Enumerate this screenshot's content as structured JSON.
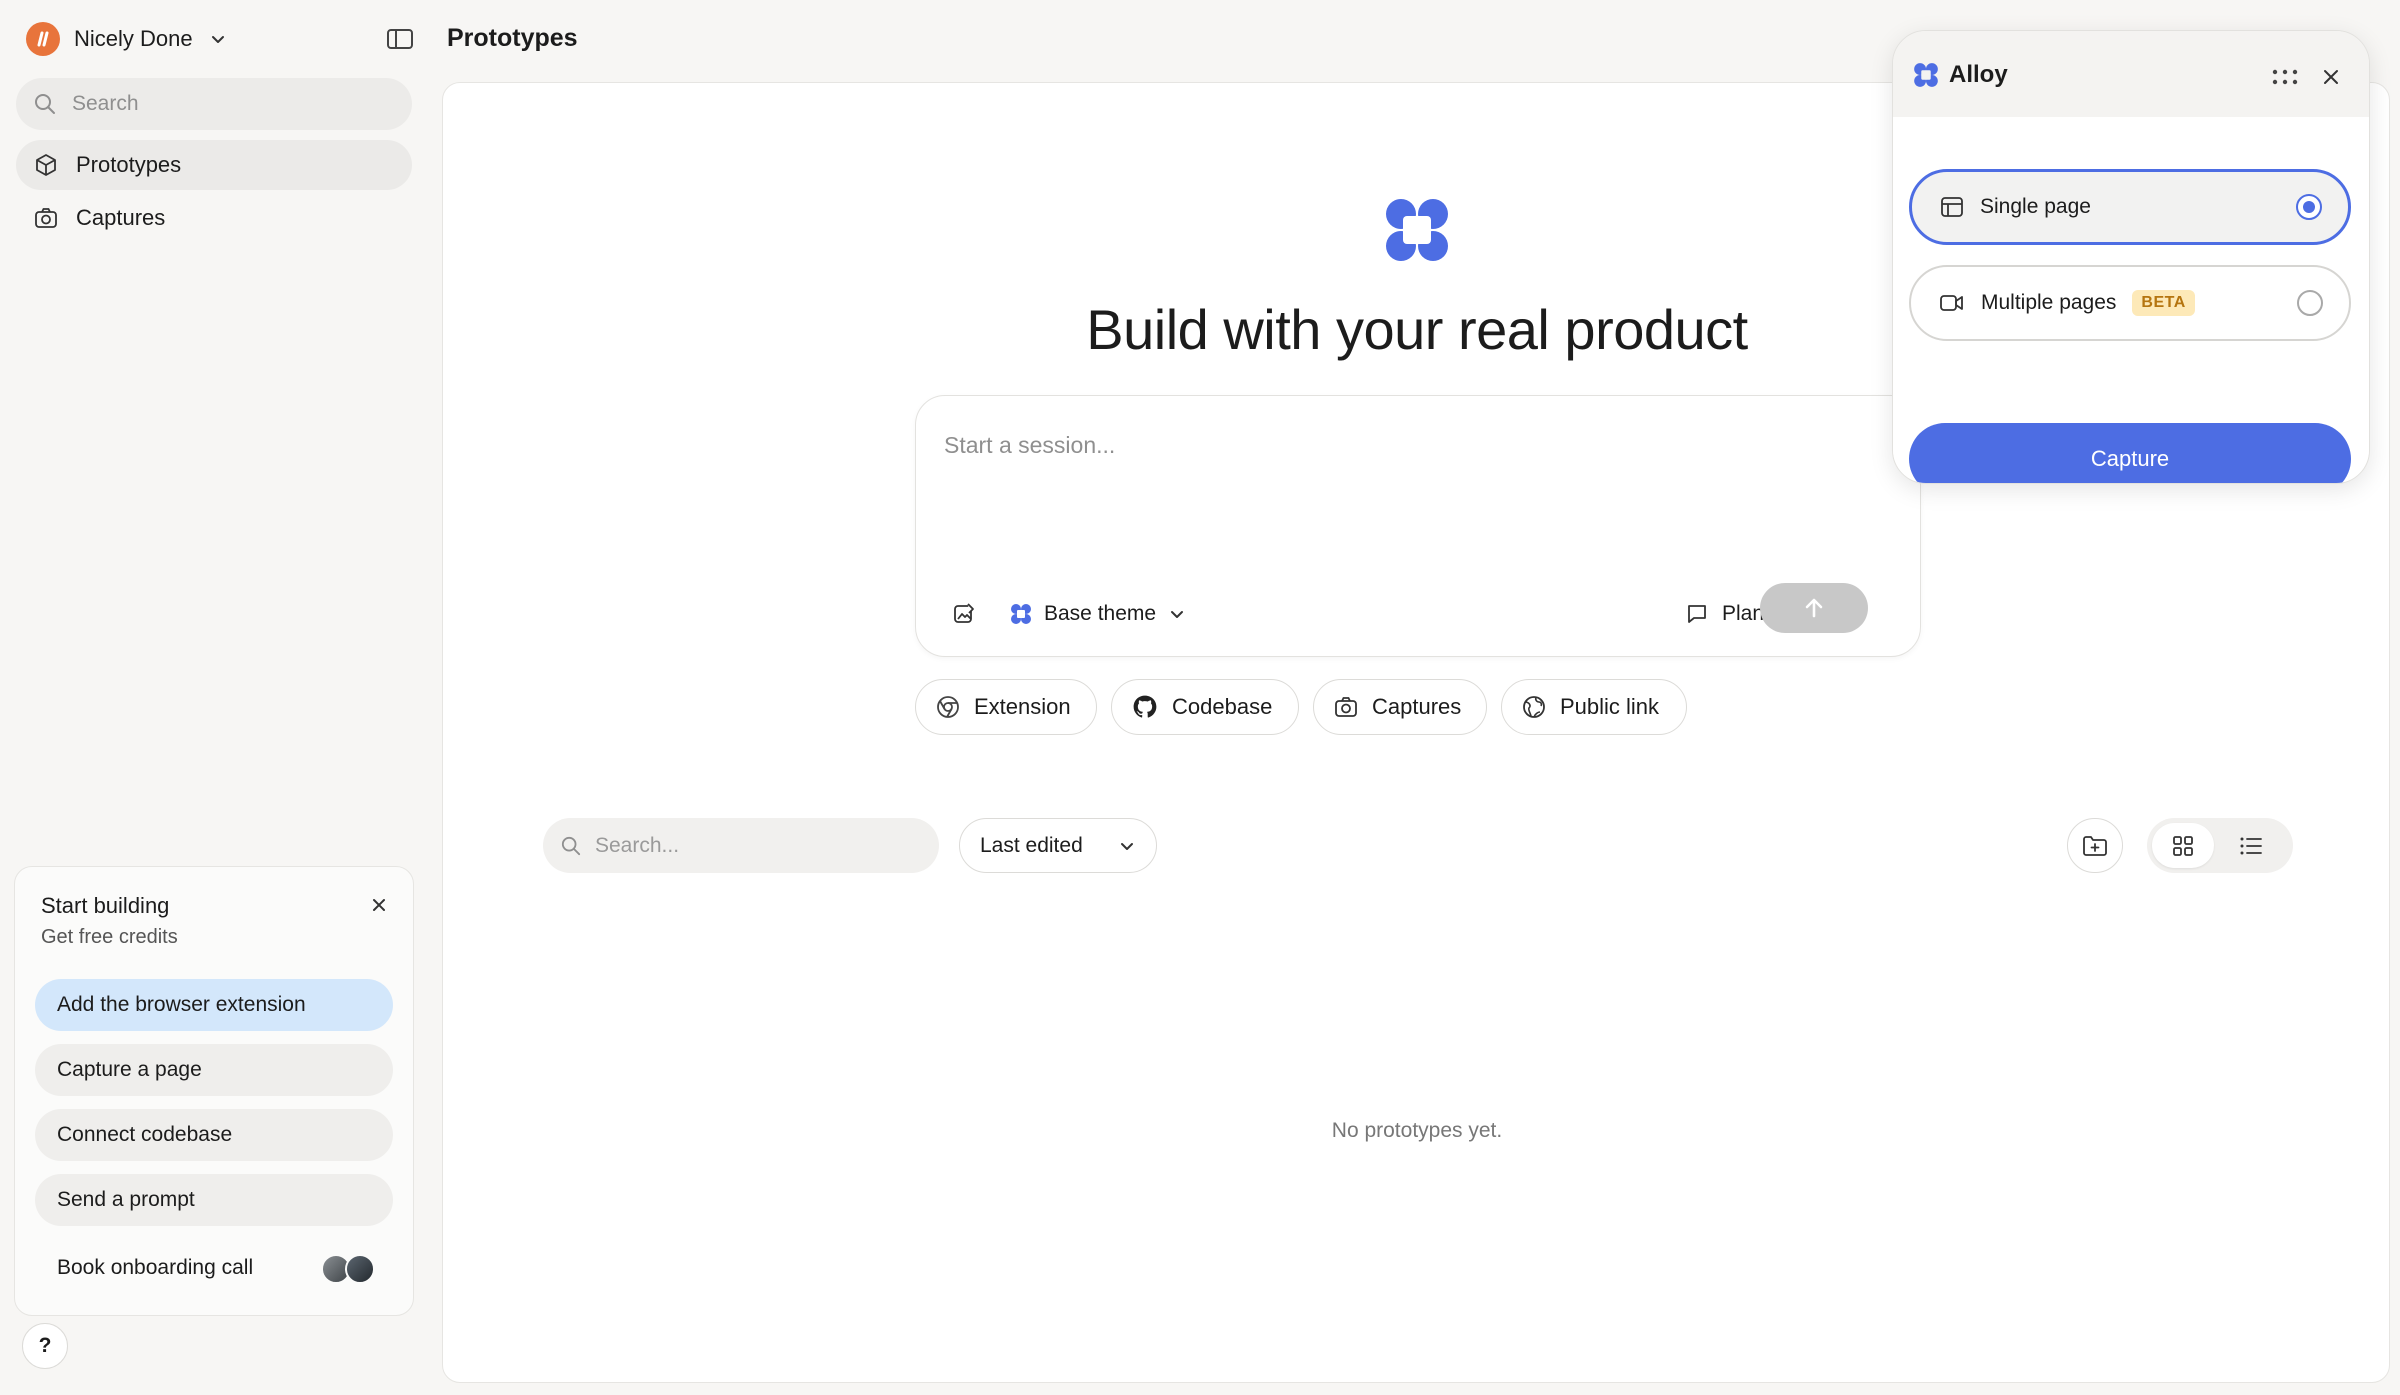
{
  "workspace": {
    "name": "Nicely Done"
  },
  "sidebar": {
    "search_placeholder": "Search",
    "items": [
      {
        "label": "Prototypes",
        "icon": "cube-icon",
        "active": true
      },
      {
        "label": "Captures",
        "icon": "camera-icon",
        "active": false
      }
    ],
    "onboarding": {
      "title": "Start building",
      "subtitle": "Get free credits",
      "tasks": [
        {
          "label": "Add the browser extension",
          "highlighted": true
        },
        {
          "label": "Capture a page"
        },
        {
          "label": "Connect codebase"
        },
        {
          "label": "Send a prompt"
        },
        {
          "label": "Book onboarding call"
        }
      ]
    },
    "help_label": "?"
  },
  "header": {
    "title": "Prototypes"
  },
  "hero": {
    "title": "Build with your real product"
  },
  "composer": {
    "placeholder": "Start a session...",
    "theme_label": "Base theme",
    "plan_label": "Plan"
  },
  "chips": [
    {
      "label": "Extension",
      "icon": "chrome-icon"
    },
    {
      "label": "Codebase",
      "icon": "github-icon"
    },
    {
      "label": "Captures",
      "icon": "camera-icon"
    },
    {
      "label": "Public link",
      "icon": "globe-icon"
    }
  ],
  "list": {
    "search_placeholder": "Search...",
    "sort_label": "Last edited",
    "empty_text": "No prototypes yet."
  },
  "popup": {
    "brand": "Alloy",
    "options": [
      {
        "label": "Single page",
        "selected": true
      },
      {
        "label": "Multiple pages",
        "badge": "BETA",
        "selected": false
      }
    ],
    "capture_label": "Capture"
  },
  "colors": {
    "accent": "#4d6de3",
    "brand_orange": "#e8743b",
    "beta_bg": "#fde9b8",
    "beta_text": "#b57510"
  }
}
